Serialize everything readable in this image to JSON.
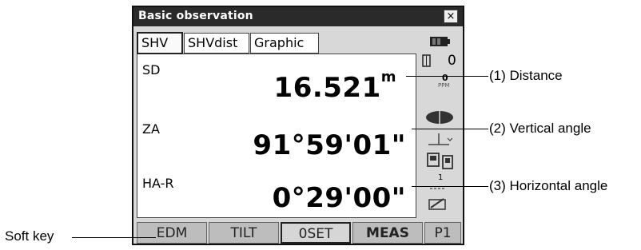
{
  "window": {
    "title": "Basic observation",
    "close_glyph": "×"
  },
  "tabs": [
    {
      "label": "SHV",
      "active": true
    },
    {
      "label": "SHVdist",
      "active": false
    },
    {
      "label": "Graphic",
      "active": false
    }
  ],
  "readings": {
    "sd": {
      "label": "SD",
      "value": "16.521",
      "unit": "m"
    },
    "za": {
      "label": "ZA",
      "value": "91°59'01\""
    },
    "har": {
      "label": "HA-R",
      "value": "0°29'00\""
    }
  },
  "status": {
    "prism_constant": "0",
    "ppm_value": "0",
    "ppm_label": "PPM",
    "channel": "1"
  },
  "softkeys": [
    "EDM",
    "TILT",
    "0SET",
    "MEAS",
    "P1"
  ],
  "callouts": {
    "distance": "(1) Distance",
    "vertical": "(2) Vertical angle",
    "horizontal": "(3) Horizontal angle",
    "softkey": "Soft key"
  }
}
